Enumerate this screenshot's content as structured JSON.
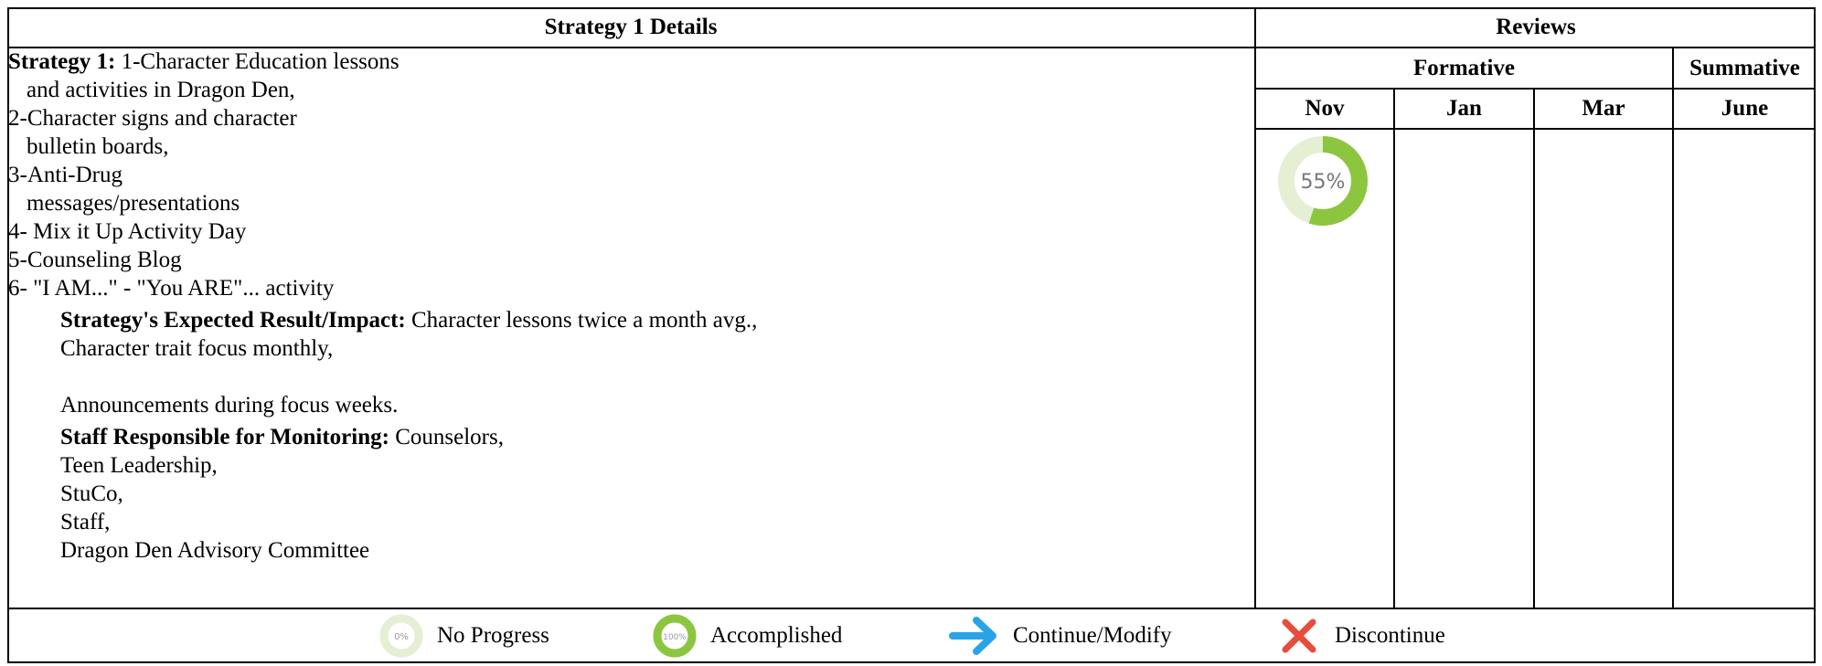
{
  "header": {
    "details_title": "Strategy 1 Details",
    "reviews_title": "Reviews",
    "formative": "Formative",
    "summative": "Summative",
    "months": [
      "Nov",
      "Jan",
      "Mar",
      "June"
    ]
  },
  "strategy": {
    "label": "Strategy 1:",
    "lines": [
      "1-Character Education lessons",
      "and activities in Dragon Den,",
      "2-Character signs and character",
      "bulletin boards,",
      "3-Anti-Drug",
      "messages/presentations",
      "4- Mix it Up Activity Day",
      "5-Counseling Blog",
      "6- \"I AM...\" - \"You ARE\"... activity"
    ],
    "expected_label": "Strategy's Expected Result/Impact:",
    "expected_lines": [
      "Character lessons twice a month avg.,",
      "Character trait focus monthly,",
      "",
      "Announcements during focus weeks."
    ],
    "staff_label": "Staff Responsible for Monitoring:",
    "staff_lines": [
      "Counselors,",
      "Teen Leadership,",
      "StuCo,",
      "Staff,",
      "Dragon Den Advisory Committee"
    ]
  },
  "review": {
    "nov_progress_label": "55%",
    "nov_progress_value": 55,
    "ring_color": "#8cc63f",
    "track_color": "#e4efd4"
  },
  "legend": {
    "no_progress_icon_text": "0%",
    "no_progress": "No Progress",
    "accomplished_icon_text": "100%",
    "accomplished": "Accomplished",
    "continue": "Continue/Modify",
    "discontinue": "Discontinue",
    "arrow_color": "#29a3e8",
    "x_color": "#e74c3c"
  }
}
